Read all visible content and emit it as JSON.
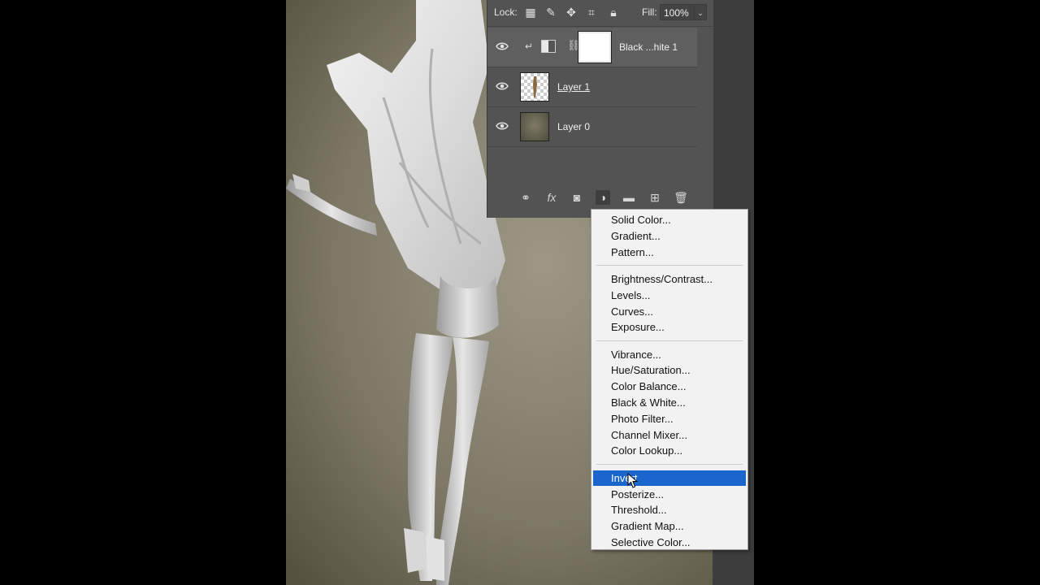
{
  "layers_panel": {
    "lock_label": "Lock:",
    "fill_label": "Fill:",
    "fill_value": "100%",
    "layers": [
      {
        "name": "Black ...hite 1",
        "type": "adjustment",
        "visible": true,
        "selected": true
      },
      {
        "name": "Layer 1",
        "type": "pixel",
        "visible": true,
        "selected": false
      },
      {
        "name": "Layer 0",
        "type": "pixel",
        "visible": true,
        "selected": false
      }
    ],
    "bottom_icons": [
      "link-layers-icon",
      "fx-icon",
      "add-mask-icon",
      "adjustment-layer-icon",
      "new-group-icon",
      "new-layer-icon",
      "delete-layer-icon"
    ],
    "fx_text": "fx"
  },
  "menu": {
    "groups": [
      [
        "Solid Color...",
        "Gradient...",
        "Pattern..."
      ],
      [
        "Brightness/Contrast...",
        "Levels...",
        "Curves...",
        "Exposure..."
      ],
      [
        "Vibrance...",
        "Hue/Saturation...",
        "Color Balance...",
        "Black & White...",
        "Photo Filter...",
        "Channel Mixer...",
        "Color Lookup..."
      ],
      [
        "Invert",
        "Posterize...",
        "Threshold...",
        "Gradient Map...",
        "Selective Color..."
      ]
    ],
    "highlighted": "Invert"
  },
  "colors": {
    "panel_bg": "#535353",
    "menu_bg": "#f2f2f2",
    "highlight": "#1a66cc",
    "canvas_bg": "#7c7865"
  }
}
